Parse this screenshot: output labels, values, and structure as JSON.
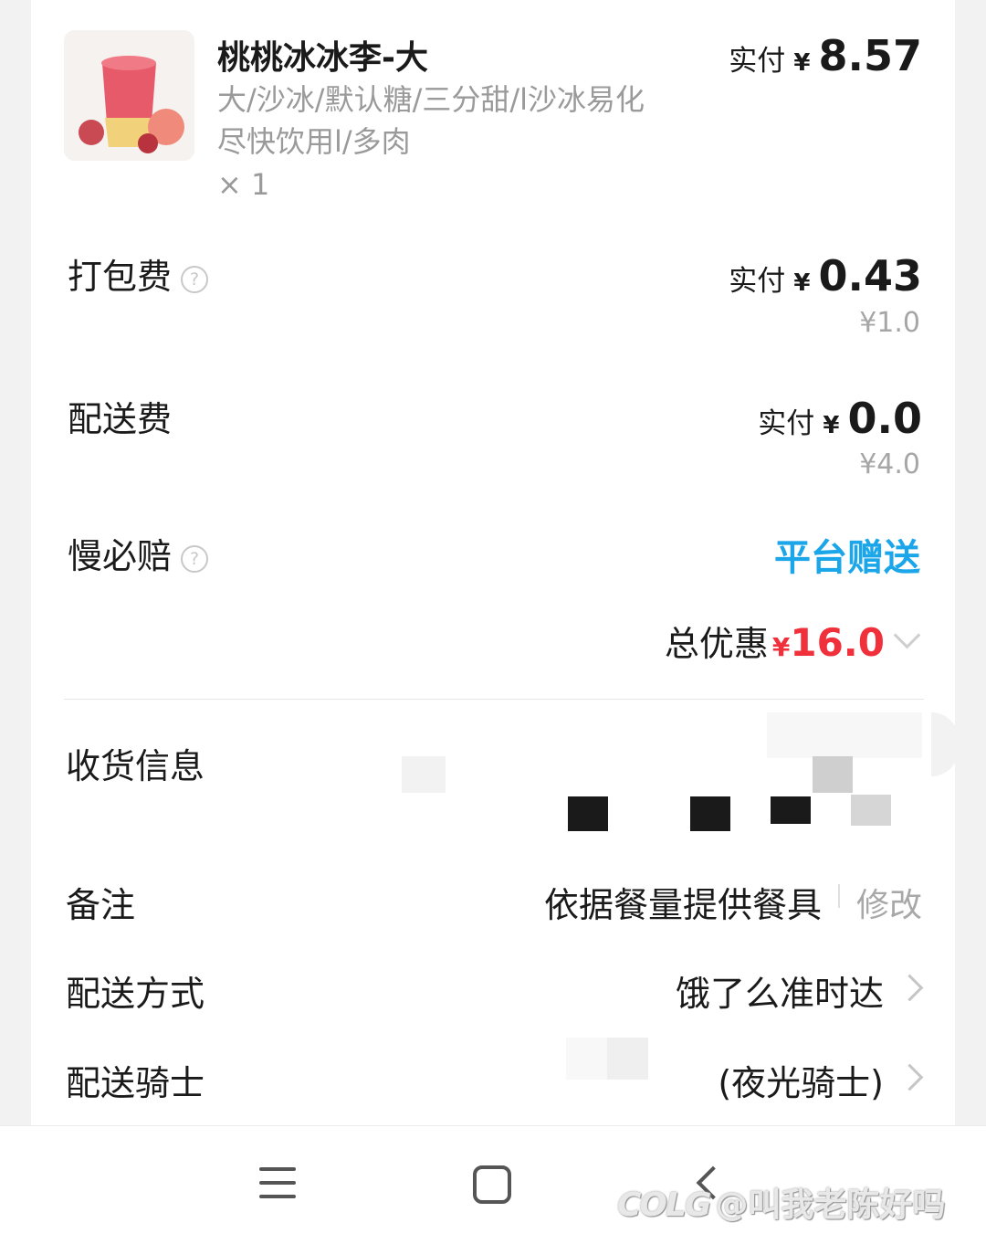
{
  "product": {
    "name": "桃桃冰冰李-大",
    "spec": "大/沙冰/默认糖/三分甜/l沙冰易化尽快饮用l/多肉",
    "quantity": "× 1",
    "paid_label": "实付",
    "currency": "¥",
    "paid_amount": "8.57"
  },
  "fees": {
    "packing": {
      "label": "打包费",
      "help_icon": "?",
      "paid_label": "实付",
      "currency": "¥",
      "paid": "0.43",
      "original": "¥1.0"
    },
    "delivery": {
      "label": "配送费",
      "paid_label": "实付",
      "currency": "¥",
      "paid": "0.0",
      "original": "¥4.0"
    },
    "late_guarantee": {
      "label": "慢必赔",
      "help_icon": "?",
      "value": "平台赠送"
    }
  },
  "discount": {
    "label": "总优惠",
    "currency": "¥",
    "amount": "16.0"
  },
  "info": {
    "receiver_label": "收货信息",
    "note_label": "备注",
    "note_value": "依据餐量提供餐具",
    "note_edit": "修改",
    "delivery_method_label": "配送方式",
    "delivery_method_value": "饿了么准时达",
    "rider_label": "配送骑士",
    "rider_value": "(夜光骑士)"
  },
  "watermark": {
    "logo": "COLG",
    "handle": "@叫我老陈好吗"
  },
  "colors": {
    "accent_blue": "#1aa6e8",
    "discount_red": "#f0303a"
  },
  "icons": [
    "question-circle-icon",
    "chevron-down-icon",
    "chevron-right-icon",
    "menu-nav-icon",
    "home-nav-icon",
    "back-nav-icon"
  ]
}
